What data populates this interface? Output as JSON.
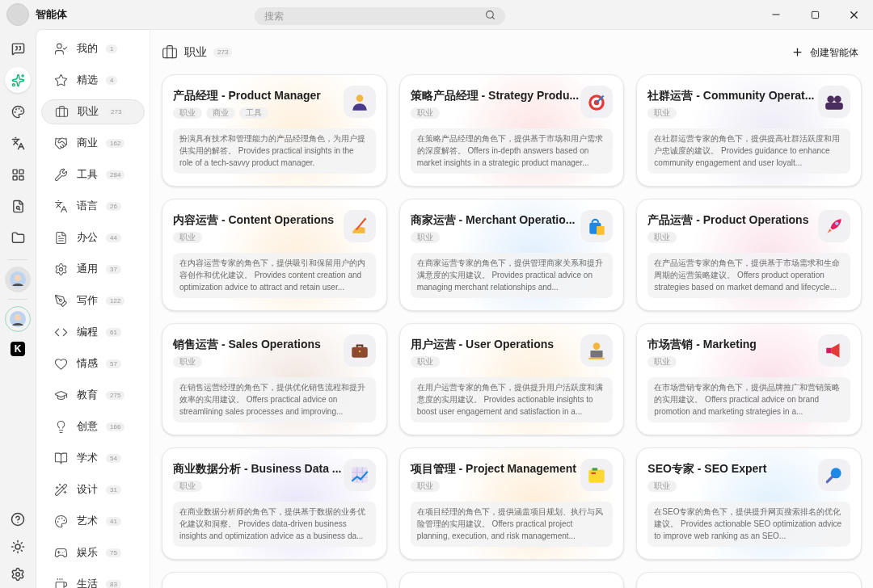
{
  "window": {
    "title": "智能体",
    "logo_text": "K"
  },
  "search": {
    "placeholder": "搜索"
  },
  "rail": [
    {
      "selected": false
    },
    {
      "selected": true
    },
    {
      "selected": false
    },
    {
      "selected": false
    },
    {
      "selected": false
    },
    {
      "selected": false
    },
    {
      "selected": false
    }
  ],
  "rail_avatars": [
    {
      "selected": true
    },
    {
      "selected": false
    }
  ],
  "categories": [
    {
      "label": "我的",
      "count": "1",
      "selected": false
    },
    {
      "label": "精选",
      "count": "4",
      "selected": false
    },
    {
      "label": "职业",
      "count": "273",
      "selected": true
    },
    {
      "label": "商业",
      "count": "162",
      "selected": false
    },
    {
      "label": "工具",
      "count": "284",
      "selected": false
    },
    {
      "label": "语言",
      "count": "26",
      "selected": false
    },
    {
      "label": "办公",
      "count": "44",
      "selected": false
    },
    {
      "label": "通用",
      "count": "37",
      "selected": false
    },
    {
      "label": "写作",
      "count": "122",
      "selected": false
    },
    {
      "label": "编程",
      "count": "61",
      "selected": false
    },
    {
      "label": "情感",
      "count": "57",
      "selected": false
    },
    {
      "label": "教育",
      "count": "275",
      "selected": false
    },
    {
      "label": "创意",
      "count": "166",
      "selected": false
    },
    {
      "label": "学术",
      "count": "54",
      "selected": false
    },
    {
      "label": "设计",
      "count": "31",
      "selected": false
    },
    {
      "label": "艺术",
      "count": "41",
      "selected": false
    },
    {
      "label": "娱乐",
      "count": "75",
      "selected": false
    },
    {
      "label": "生活",
      "count": "83",
      "selected": false
    }
  ],
  "header": {
    "title": "职业",
    "count": "273",
    "create_button": "创建智能体"
  },
  "cards": [
    {
      "title": "产品经理 - Product Manager",
      "tags": [
        "职业",
        "商业",
        "工具"
      ],
      "description": "扮演具有技术和管理能力的产品经理角色，为用户提供实用的解答。 Provides practical insights in the role of a tech-savvy product manager."
    },
    {
      "title": "策略产品经理 - Strategy Produ...",
      "tags": [
        "职业"
      ],
      "description": "在策略产品经理的角色下，提供基于市场和用户需求的深度解答。 Offers in-depth answers based on market insights in a strategic product manager..."
    },
    {
      "title": "社群运营 - Community Operat...",
      "tags": [
        "职业"
      ],
      "description": "在社群运营专家的角色下，提供提高社群活跃度和用户忠诚度的建议。 Provides guidance to enhance community engagement and user loyalt..."
    },
    {
      "title": "内容运营 - Content Operations",
      "tags": [
        "职业"
      ],
      "description": "在内容运营专家的角色下，提供吸引和保留用户的内容创作和优化建议。 Provides content creation and optimization advice to attract and retain user..."
    },
    {
      "title": "商家运营 - Merchant Operatio...",
      "tags": [
        "职业"
      ],
      "description": "在商家运营专家的角色下，提供管理商家关系和提升满意度的实用建议。 Provides practical advice on managing merchant relationships and..."
    },
    {
      "title": "产品运营 - Product Operations",
      "tags": [
        "职业"
      ],
      "description": "在产品运营专家的角色下，提供基于市场需求和生命周期的运营策略建议。 Offers product operation strategies based on market demand and lifecycle..."
    },
    {
      "title": "销售运营 - Sales Operations",
      "tags": [
        "职业"
      ],
      "description": "在销售运营经理的角色下，提供优化销售流程和提升效率的实用建议。 Offers practical advice on streamlining sales processes and improving..."
    },
    {
      "title": "用户运营 - User Operations",
      "tags": [
        "职业"
      ],
      "description": "在用户运营专家的角色下，提供提升用户活跃度和满意度的实用建议。 Provides actionable insights to boost user engagement and satisfaction in a..."
    },
    {
      "title": "市场营销 - Marketing",
      "tags": [
        "职业"
      ],
      "description": "在市场营销专家的角色下，提供品牌推广和营销策略的实用建议。 Offers practical advice on brand promotion and marketing strategies in a..."
    },
    {
      "title": "商业数据分析 - Business Data ...",
      "tags": [
        "职业"
      ],
      "description": "在商业数据分析师的角色下，提供基于数据的业务优化建议和洞察。 Provides data-driven business insights and optimization advice as a business da..."
    },
    {
      "title": "项目管理 - Project Management",
      "tags": [
        "职业"
      ],
      "description": "在项目经理的角色下，提供涵盖项目规划、执行与风险管理的实用建议。 Offers practical project planning, execution, and risk management..."
    },
    {
      "title": "SEO专家 - SEO Expert",
      "tags": [
        "职业"
      ],
      "description": "在SEO专家的角色下，提供提升网页搜索排名的优化建议。 Provides actionable SEO optimization advice to improve web ranking as an SEO..."
    }
  ]
}
